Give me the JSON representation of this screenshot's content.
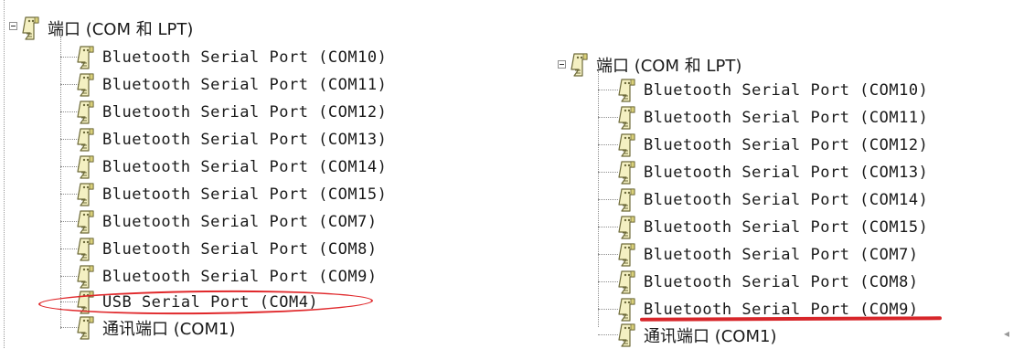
{
  "panels": [
    {
      "category": {
        "label": "端口 (COM 和 LPT)",
        "icon": "serial-port-icon",
        "state": "expanded"
      },
      "devices": [
        {
          "label": "Bluetooth Serial Port (COM10)",
          "icon": "serial-port-icon"
        },
        {
          "label": "Bluetooth Serial Port (COM11)",
          "icon": "serial-port-icon"
        },
        {
          "label": "Bluetooth Serial Port (COM12)",
          "icon": "serial-port-icon"
        },
        {
          "label": "Bluetooth Serial Port (COM13)",
          "icon": "serial-port-icon"
        },
        {
          "label": "Bluetooth Serial Port (COM14)",
          "icon": "serial-port-icon"
        },
        {
          "label": "Bluetooth Serial Port (COM15)",
          "icon": "serial-port-icon"
        },
        {
          "label": "Bluetooth Serial Port (COM7)",
          "icon": "serial-port-icon"
        },
        {
          "label": "Bluetooth Serial Port (COM8)",
          "icon": "serial-port-icon"
        },
        {
          "label": "Bluetooth Serial Port (COM9)",
          "icon": "serial-port-icon"
        },
        {
          "label": "USB Serial Port (COM4)",
          "icon": "serial-port-icon",
          "annotation": "red-ellipse"
        },
        {
          "label": "通讯端口 (COM1)",
          "icon": "serial-port-icon"
        }
      ]
    },
    {
      "category": {
        "label": "端口 (COM 和 LPT)",
        "icon": "serial-port-icon",
        "state": "expanded"
      },
      "devices": [
        {
          "label": "Bluetooth Serial Port (COM10)",
          "icon": "serial-port-icon"
        },
        {
          "label": "Bluetooth Serial Port (COM11)",
          "icon": "serial-port-icon"
        },
        {
          "label": "Bluetooth Serial Port (COM12)",
          "icon": "serial-port-icon"
        },
        {
          "label": "Bluetooth Serial Port (COM13)",
          "icon": "serial-port-icon"
        },
        {
          "label": "Bluetooth Serial Port (COM14)",
          "icon": "serial-port-icon"
        },
        {
          "label": "Bluetooth Serial Port (COM15)",
          "icon": "serial-port-icon"
        },
        {
          "label": "Bluetooth Serial Port (COM7)",
          "icon": "serial-port-icon"
        },
        {
          "label": "Bluetooth Serial Port (COM8)",
          "icon": "serial-port-icon"
        },
        {
          "label": "Bluetooth Serial Port (COM9)",
          "icon": "serial-port-icon",
          "annotation": "red-underline"
        },
        {
          "label": "通讯端口 (COM1)",
          "icon": "serial-port-icon"
        }
      ]
    }
  ],
  "annotation_color": "#e0282b"
}
